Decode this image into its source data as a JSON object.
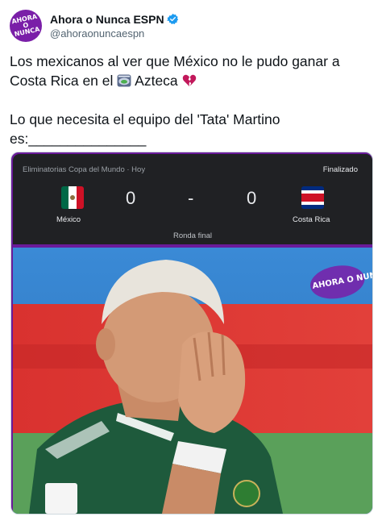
{
  "account": {
    "display_name": "Ahora o Nunca ESPN",
    "handle": "@ahoraonuncaespn",
    "avatar_text": "AHORA O NUNCA"
  },
  "tweet": {
    "line1": "Los mexicanos al ver que México no le pudo ganar a",
    "line2a": "Costa Rica en el ",
    "line2b": " Azteca ",
    "line3": "Lo que necesita el equipo del 'Tata' Martino",
    "line4": "es:_______________"
  },
  "match": {
    "meta": "Eliminatorias Copa del Mundo · Hoy",
    "status": "Finalizado",
    "home_team": "México",
    "away_team": "Costa Rica",
    "home_score": "0",
    "separator": "-",
    "away_score": "0",
    "round": "Ronda final"
  },
  "photo": {
    "watermark": "AHORA O NUNCA"
  },
  "colors": {
    "brand_purple": "#7a1fa8",
    "verified_blue": "#1d9bf0",
    "mx_green": "#006847",
    "mx_red": "#ce1126",
    "cr_blue": "#002b7f",
    "cr_red": "#ce1126"
  },
  "icons": [
    "verified-badge-icon",
    "stadium-icon",
    "broken-heart-icon"
  ]
}
